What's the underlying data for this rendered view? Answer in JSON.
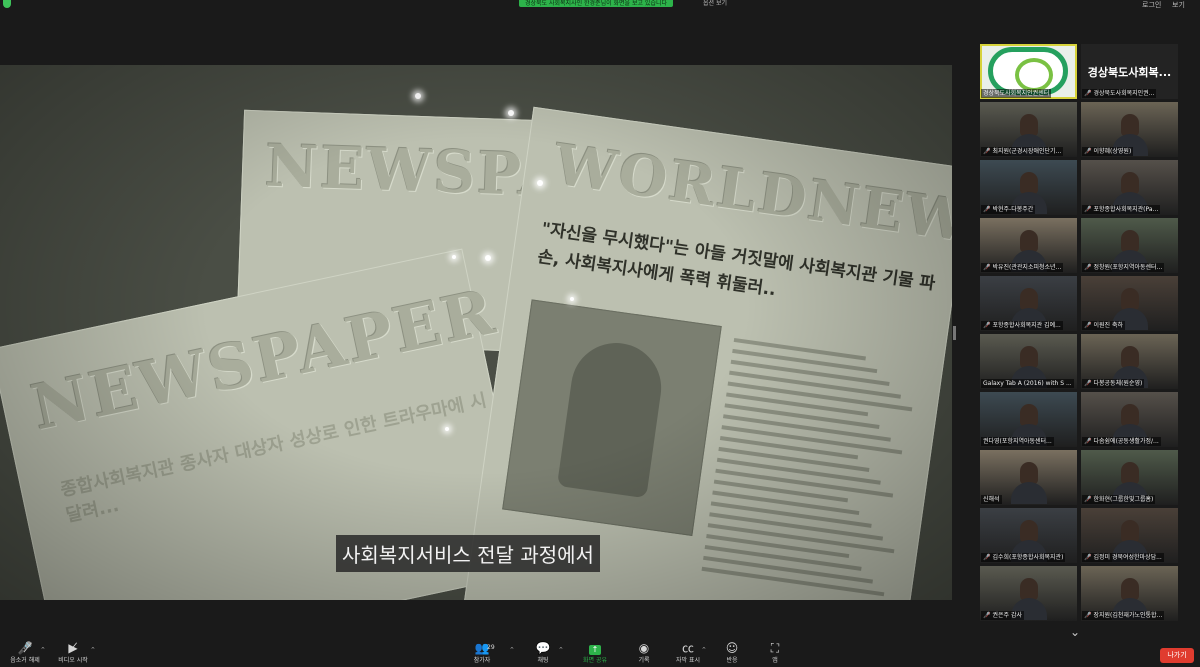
{
  "topbar": {
    "share_banner": "경상북도 사회복지사인 한경준님이 화면을 보고 있습니다",
    "banner_button": "옵션 보기",
    "login": "로그인",
    "view": "보기"
  },
  "colors": {
    "accent_green": "#2db34a",
    "leave_red": "#e03c2f",
    "active_speaker": "#d6d23a"
  },
  "stage": {
    "mast1": "NEWSPAPER",
    "mast2": "WORLDNEWS",
    "mast3": "NEWSPAPER",
    "headline": "\"자신을 무시했다\"는 아들 거짓말에 사회복지관 기물 파손, 사회복지사에게 폭력 휘둘러..",
    "sub_headline": "종합사회복지관 종사자 대상자 성상로 인한 트라우마에 시달려...",
    "subtitle": "사회복지서비스 전달 과정에서"
  },
  "gallery": {
    "tiles": [
      {
        "name": "경상북도사회복지인권센터",
        "muted": false,
        "kind": "logo"
      },
      {
        "name": "경상북도사회복지인권...",
        "muted": true,
        "big": "경상북도사회복...",
        "kind": "text"
      },
      {
        "name": "최지원(군경시장애인단기...",
        "muted": true,
        "kind": "video"
      },
      {
        "name": "이향혜(상영원)",
        "muted": true,
        "kind": "video"
      },
      {
        "name": "박현주-다봉주간",
        "muted": true,
        "kind": "video"
      },
      {
        "name": "포항종합사회복지관(Pa...",
        "muted": true,
        "kind": "video"
      },
      {
        "name": "박유진(관관지소피청소년...",
        "muted": true,
        "kind": "video"
      },
      {
        "name": "정창원(포항지역아동센터...",
        "muted": true,
        "kind": "video"
      },
      {
        "name": "포항종합사회복지관 김예...",
        "muted": true,
        "kind": "video"
      },
      {
        "name": "이원진 축하",
        "muted": true,
        "kind": "video"
      },
      {
        "name": "Galaxy Tab A (2016) with S ...",
        "muted": false,
        "kind": "video"
      },
      {
        "name": "다봉공동체(원순영)",
        "muted": true,
        "kind": "video"
      },
      {
        "name": "권다영(포항지역아동센터...",
        "muted": false,
        "kind": "video"
      },
      {
        "name": "다솜쉼에(공동생활가정/...",
        "muted": true,
        "kind": "video"
      },
      {
        "name": "신해석",
        "muted": false,
        "kind": "video"
      },
      {
        "name": "한화현(그룹한빛그룹홈)",
        "muted": true,
        "kind": "video"
      },
      {
        "name": "김수희(포항종합사회복지관)",
        "muted": true,
        "kind": "video"
      },
      {
        "name": "김정미 경북여성한마상담...",
        "muted": true,
        "kind": "video"
      },
      {
        "name": "권은주 감사",
        "muted": true,
        "kind": "video"
      },
      {
        "name": "장지원(김천재가노인통합...",
        "muted": true,
        "kind": "video"
      }
    ],
    "more_icon": "chevron-down-icon"
  },
  "toolbar": {
    "mic_label": "음소거 해제",
    "video_label": "비디오 시작",
    "participants_label": "참가자",
    "participants_count": "29",
    "chat_label": "채팅",
    "share_label": "화면 공유",
    "record_label": "기록",
    "captions_label": "자막 표시",
    "reactions_label": "반응",
    "apps_label": "앱",
    "leave_label": "나가기"
  }
}
